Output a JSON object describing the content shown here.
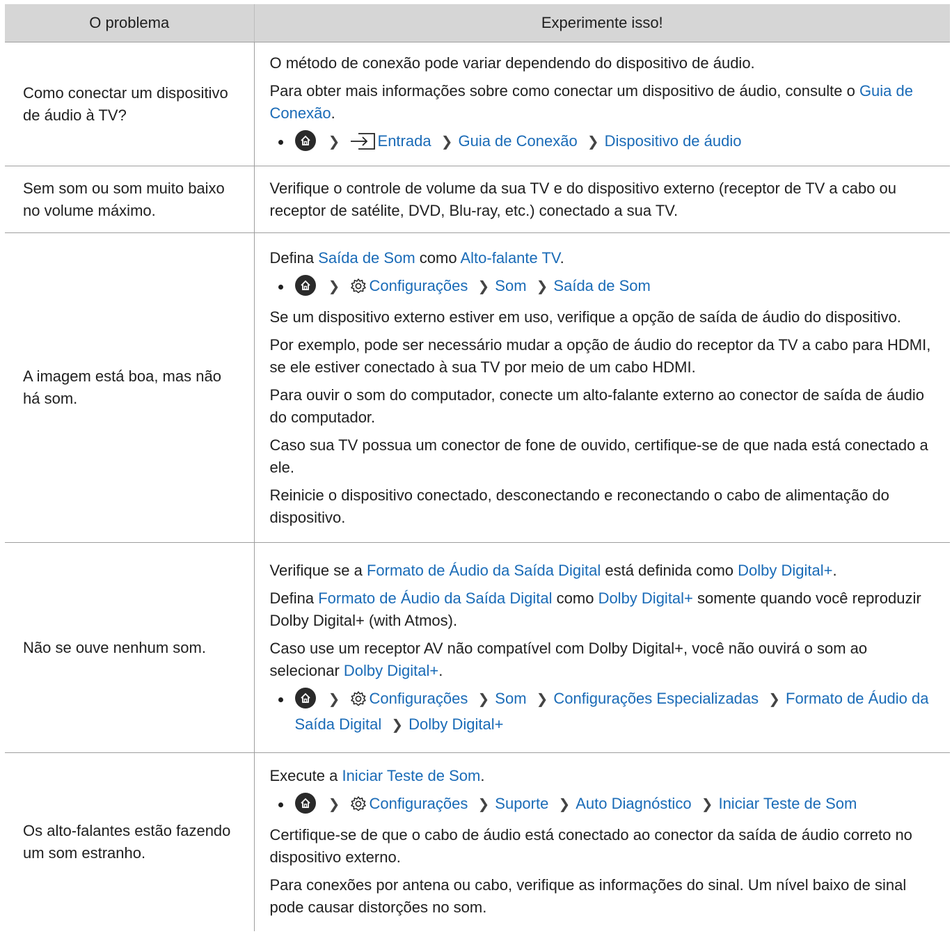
{
  "header": {
    "col1": "O problema",
    "col2": "Experimente isso!"
  },
  "rows": [
    {
      "problem": "Como conectar um dispositivo de áudio à TV?",
      "p1": "O método de conexão pode variar dependendo do dispositivo de áudio.",
      "p2_text": "Para obter mais informações sobre como conectar um dispositivo de áudio, consulte o ",
      "p2_link": "Guia de Conexão",
      "p2_end": ".",
      "path": [
        "Entrada",
        "Guia de Conexão",
        "Dispositivo de áudio"
      ]
    },
    {
      "problem": "Sem som ou som muito baixo no volume máximo.",
      "p1": "Verifique o controle de volume da sua TV e do dispositivo externo (receptor de TV a cabo ou receptor de satélite, DVD, Blu-ray, etc.) conectado a sua TV."
    },
    {
      "problem": "A imagem está boa, mas não há som.",
      "p1_a": "Defina ",
      "p1_link1": "Saída de Som",
      "p1_b": " como ",
      "p1_link2": "Alto-falante TV",
      "p1_c": ".",
      "path": [
        "Configurações",
        "Som",
        "Saída de Som"
      ],
      "p2": "Se um dispositivo externo estiver em uso, verifique a opção de saída de áudio do dispositivo.",
      "p3": "Por exemplo, pode ser necessário mudar a opção de áudio do receptor da TV a cabo para HDMI, se ele estiver conectado à sua TV por meio de um cabo HDMI.",
      "p4": "Para ouvir o som do computador, conecte um alto-falante externo ao conector de saída de áudio do computador.",
      "p5": "Caso sua TV possua um conector de fone de ouvido, certifique-se de que nada está conectado a ele.",
      "p6": "Reinicie o dispositivo conectado, desconectando e reconectando o cabo de alimentação do dispositivo."
    },
    {
      "problem": "Não se ouve nenhum som.",
      "p1_a": "Verifique se a ",
      "p1_link1": "Formato de Áudio da Saída Digital",
      "p1_b": " está definida como ",
      "p1_link2": "Dolby Digital+",
      "p1_c": ".",
      "p2_a": "Defina ",
      "p2_link1": "Formato de Áudio da Saída Digital",
      "p2_b": " como ",
      "p2_link2": "Dolby Digital+",
      "p2_c": " somente quando você reproduzir Dolby Digital+ (with Atmos).",
      "p3_a": "Caso use um receptor AV não compatível com Dolby Digital+, você não ouvirá o som ao selecionar ",
      "p3_link": "Dolby Digital+",
      "p3_c": ".",
      "path": [
        "Configurações",
        "Som",
        "Configurações Especializadas",
        "Formato de Áudio da Saída Digital",
        "Dolby Digital+"
      ]
    },
    {
      "problem": "Os alto-falantes estão fazendo um som estranho.",
      "p1_a": "Execute a ",
      "p1_link": "Iniciar Teste de Som",
      "p1_c": ".",
      "path": [
        "Configurações",
        "Suporte",
        "Auto Diagnóstico",
        "Iniciar Teste de Som"
      ],
      "p2": "Certifique-se de que o cabo de áudio está conectado ao conector da saída de áudio correto no dispositivo externo.",
      "p3": "Para conexões por antena ou cabo, verifique as informações do sinal. Um nível baixo de sinal pode causar distorções no som."
    }
  ],
  "icons": {
    "home": "home-icon",
    "settings": "gear-icon",
    "source": "source-input-icon",
    "chevron": "chevron-right-icon"
  },
  "colors": {
    "link": "#1a6bb7",
    "header_bg": "#d6d6d6",
    "border": "#9e9e9e"
  }
}
